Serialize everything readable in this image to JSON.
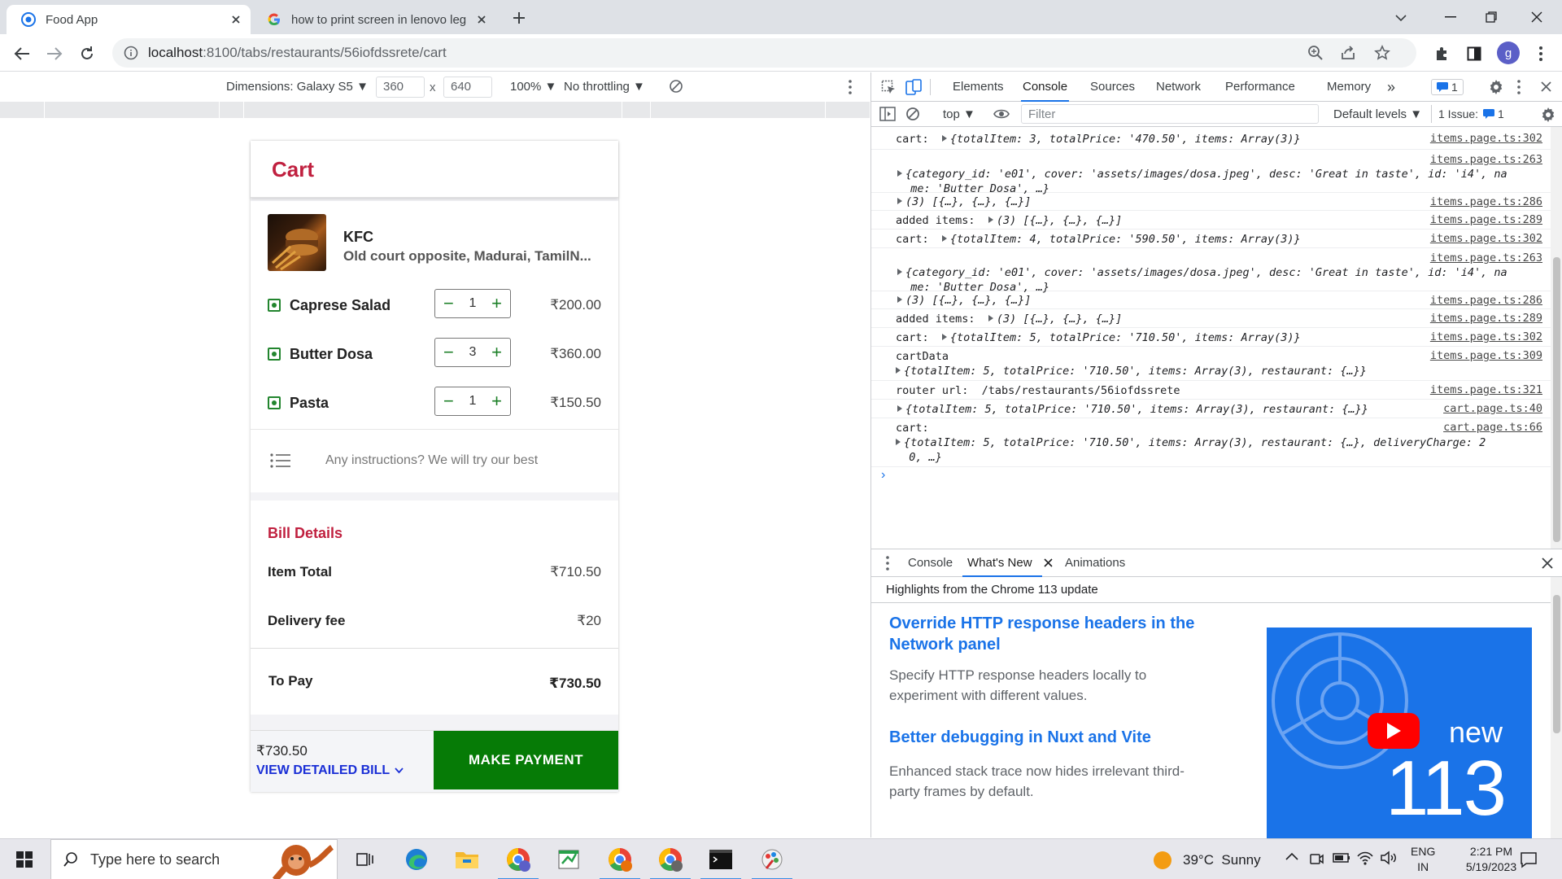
{
  "browser": {
    "tabs": [
      {
        "title": "Food App",
        "active": true
      },
      {
        "title": "how to print screen in lenovo leg",
        "active": false
      }
    ],
    "url_host": "localhost",
    "url_path": ":8100/tabs/restaurants/56iofdssrete/cart",
    "profile_initial": "g"
  },
  "device_toolbar": {
    "dimensions_label": "Dimensions: Galaxy S5 ▼",
    "width": "360",
    "height": "640",
    "times": "x",
    "zoom": "100% ▼",
    "throttling": "No throttling ▼"
  },
  "app": {
    "page_title": "Cart",
    "restaurant": {
      "name": "KFC",
      "address": "Old court opposite, Madurai, TamilN..."
    },
    "items": [
      {
        "name": "Caprese Salad",
        "qty": "1",
        "price": "₹200.00"
      },
      {
        "name": "Butter Dosa",
        "qty": "3",
        "price": "₹360.00"
      },
      {
        "name": "Pasta",
        "qty": "1",
        "price": "₹150.50"
      }
    ],
    "instructions_placeholder": "Any instructions? We will try our best",
    "bill": {
      "heading": "Bill Details",
      "item_total_label": "Item Total",
      "item_total": "₹710.50",
      "delivery_label": "Delivery fee",
      "delivery": "₹20",
      "to_pay_label": "To Pay",
      "to_pay": "₹730.50"
    },
    "footer": {
      "amount": "₹730.50",
      "detail_link": "VIEW DETAILED BILL",
      "pay_button": "MAKE PAYMENT"
    },
    "colors": {
      "brand": "#c0203f",
      "pay": "#067b06",
      "veg": "#22852e",
      "link": "#1a2fd6"
    }
  },
  "devtools": {
    "tabs": [
      "Elements",
      "Console",
      "Sources",
      "Network",
      "Performance",
      "Memory"
    ],
    "active_tab": "Console",
    "more": "»",
    "issues_badge": "1",
    "context": "top ▼",
    "filter_placeholder": "Filter",
    "levels": "Default levels ▼",
    "issues_label": "1 Issue:",
    "issues_count": "1",
    "console": [
      {
        "label": "cart:",
        "value": "{totalItem: 3, totalPrice: '470.50', items: Array(3)}",
        "src": "items.page.ts:302"
      },
      {
        "label": "",
        "value": "{category_id: 'e01', cover: 'assets/images/dosa.jpeg', desc: 'Great in taste', id: 'i4', na",
        "value2": "me: 'Butter Dosa', …}",
        "src": "items.page.ts:263"
      },
      {
        "label": "",
        "value": "(3) [{…}, {…}, {…}]",
        "src": "items.page.ts:286"
      },
      {
        "label": "added items:",
        "value": "(3) [{…}, {…}, {…}]",
        "src": "items.page.ts:289"
      },
      {
        "label": "cart:",
        "value": "{totalItem: 4, totalPrice: '590.50', items: Array(3)}",
        "src": "items.page.ts:302"
      },
      {
        "label": "",
        "value": "{category_id: 'e01', cover: 'assets/images/dosa.jpeg', desc: 'Great in taste', id: 'i4', na",
        "value2": "me: 'Butter Dosa', …}",
        "src": "items.page.ts:263"
      },
      {
        "label": "",
        "value": "(3) [{…}, {…}, {…}]",
        "src": "items.page.ts:286"
      },
      {
        "label": "added items:",
        "value": "(3) [{…}, {…}, {…}]",
        "src": "items.page.ts:289"
      },
      {
        "label": "cart:",
        "value": "{totalItem: 5, totalPrice: '710.50', items: Array(3)}",
        "src": "items.page.ts:302"
      },
      {
        "label": "cartData",
        "value": "{totalItem: 5, totalPrice: '710.50', items: Array(3), restaurant: {…}}",
        "src": "items.page.ts:309"
      },
      {
        "label": "router url:",
        "value": "/tabs/restaurants/56iofdssrete",
        "src": "items.page.ts:321"
      },
      {
        "label": "",
        "value": "{totalItem: 5, totalPrice: '710.50', items: Array(3), restaurant: {…}}",
        "src": "cart.page.ts:40"
      },
      {
        "label": "cart:",
        "value": "{totalItem: 5, totalPrice: '710.50', items: Array(3), restaurant: {…}, deliveryCharge: 2",
        "value2": "0, …}",
        "src": "cart.page.ts:66"
      }
    ],
    "prompt": "›",
    "drawer": {
      "tabs": [
        "Console",
        "What's New",
        "Animations"
      ],
      "header": "Highlights from the Chrome 113 update",
      "items": [
        {
          "title": "Override HTTP response headers in the Network panel",
          "body": "Specify HTTP response headers locally to experiment with different values."
        },
        {
          "title": "Better debugging in Nuxt and Vite",
          "body": "Enhanced stack trace now hides irrelevant third-party frames by default."
        }
      ],
      "banner_new": "new",
      "banner_version": "113"
    }
  },
  "taskbar": {
    "search_placeholder": "Type here to search",
    "weather": "39°C  Sunny",
    "lang_top": "ENG",
    "lang_bottom": "IN",
    "time": "2:21 PM",
    "date": "5/19/2023"
  }
}
